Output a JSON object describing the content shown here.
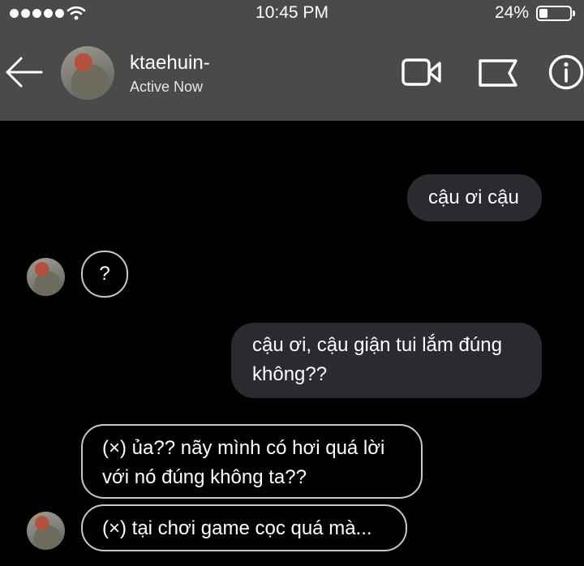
{
  "status_bar": {
    "time": "10:45 PM",
    "battery_percent": "24%",
    "signal_bars": 5,
    "battery_level": 0.24
  },
  "header": {
    "contact_name": "ktaehuin-",
    "contact_status": "Active Now",
    "icons": [
      "back-arrow-icon",
      "video-call-icon",
      "flag-icon",
      "info-icon"
    ],
    "background_color": "#4a4a4a"
  },
  "messages": [
    {
      "direction": "sent",
      "text": "cậu ơi cậu"
    },
    {
      "direction": "received",
      "text": "?"
    },
    {
      "direction": "sent",
      "text": "cậu ơi, cậu giận tui lắm đúng không??"
    },
    {
      "direction": "received",
      "text": "(×) ủa?? nãy mình có hơi quá lời với nó đúng không ta??"
    },
    {
      "direction": "received",
      "text": "(×) tại chơi game cọc quá mà..."
    }
  ],
  "colors": {
    "sent_bubble": "#2b2a31",
    "received_border": "#c8c8c8",
    "background": "#000000"
  }
}
